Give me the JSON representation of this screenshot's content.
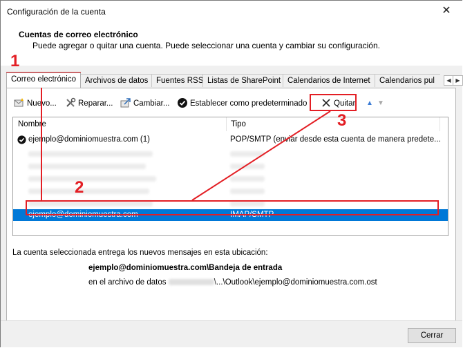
{
  "window": {
    "title": "Configuración de la cuenta",
    "close_glyph": "✕"
  },
  "header": {
    "title": "Cuentas de correo electrónico",
    "description": "Puede agregar o quitar una cuenta. Puede seleccionar una cuenta y cambiar su configuración."
  },
  "tabs": [
    {
      "label": "Correo electrónico",
      "active": true
    },
    {
      "label": "Archivos de datos"
    },
    {
      "label": "Fuentes RSS"
    },
    {
      "label": "Listas de SharePoint"
    },
    {
      "label": "Calendarios de Internet"
    },
    {
      "label": "Calendarios pul"
    }
  ],
  "tab_scroll": {
    "left_glyph": "◀",
    "right_glyph": "▶"
  },
  "toolbar": {
    "new_label": "Nuevo...",
    "repair_label": "Reparar...",
    "change_label": "Cambiar...",
    "set_default_label": "Establecer como predeterminado",
    "remove_label": "Quitar",
    "move_up_glyph": "▲",
    "move_down_glyph": "▼"
  },
  "accounts_table": {
    "columns": [
      "Nombre",
      "Tipo"
    ],
    "rows": [
      {
        "name": "ejemplo@dominiomuestra.com (1)",
        "type": "POP/SMTP (enviar desde esta cuenta de manera predete...",
        "default": true
      },
      {
        "name": "",
        "type": "",
        "blurred": true
      },
      {
        "name": "",
        "type": "",
        "blurred": true
      },
      {
        "name": "",
        "type": "",
        "blurred": true
      },
      {
        "name": "",
        "type": "",
        "blurred": true
      },
      {
        "name": "",
        "type": "",
        "blurred": true
      },
      {
        "name": "ejemplo@dominiomuestra.com",
        "type": "IMAP/SMTP",
        "selected": true
      }
    ]
  },
  "delivery": {
    "intro": "La cuenta seleccionada entrega los nuevos mensajes en esta ubicación:",
    "folder": "ejemplo@dominiomuestra.com\\Bandeja de entrada",
    "file_prefix": "en el archivo de datos",
    "file_path": "\\...\\Outlook\\ejemplo@dominiomuestra.com.ost"
  },
  "footer": {
    "close_label": "Cerrar"
  },
  "annotations": {
    "step1": "1",
    "step2": "2",
    "step3": "3",
    "color": "#e31e24"
  },
  "colors": {
    "selection": "#0078d7",
    "annotation": "#e31e24"
  }
}
